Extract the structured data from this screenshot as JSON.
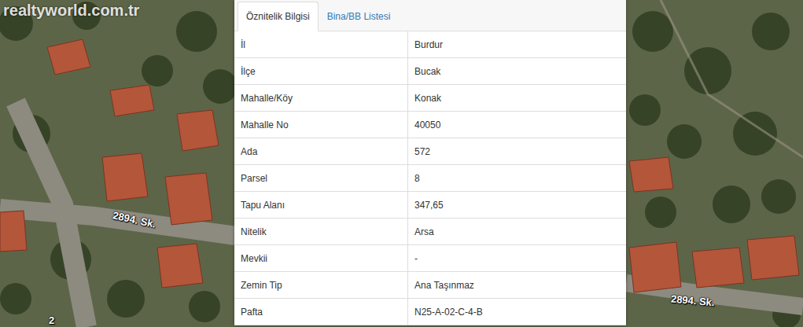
{
  "watermark": "realtyworld.com.tr",
  "map": {
    "labels": [
      {
        "text": "2894. Sk."
      },
      {
        "text": "2894. Sk."
      },
      {
        "text": "2"
      }
    ]
  },
  "panel": {
    "tabs": [
      {
        "label": "Öznitelik Bilgisi",
        "selected": true
      },
      {
        "label": "Bina/BB Listesi",
        "selected": false
      }
    ],
    "rows": [
      {
        "label": "İl",
        "value": "Burdur"
      },
      {
        "label": "İlçe",
        "value": "Bucak"
      },
      {
        "label": "Mahalle/Köy",
        "value": "Konak"
      },
      {
        "label": "Mahalle No",
        "value": "40050"
      },
      {
        "label": "Ada",
        "value": "572"
      },
      {
        "label": "Parsel",
        "value": "8"
      },
      {
        "label": "Tapu Alanı",
        "value": "347,65"
      },
      {
        "label": "Nitelik",
        "value": "Arsa"
      },
      {
        "label": "Mevkii",
        "value": "-"
      },
      {
        "label": "Zemin Tip",
        "value": "Ana Taşınmaz"
      },
      {
        "label": "Pafta",
        "value": "N25-A-02-C-4-B"
      }
    ]
  }
}
